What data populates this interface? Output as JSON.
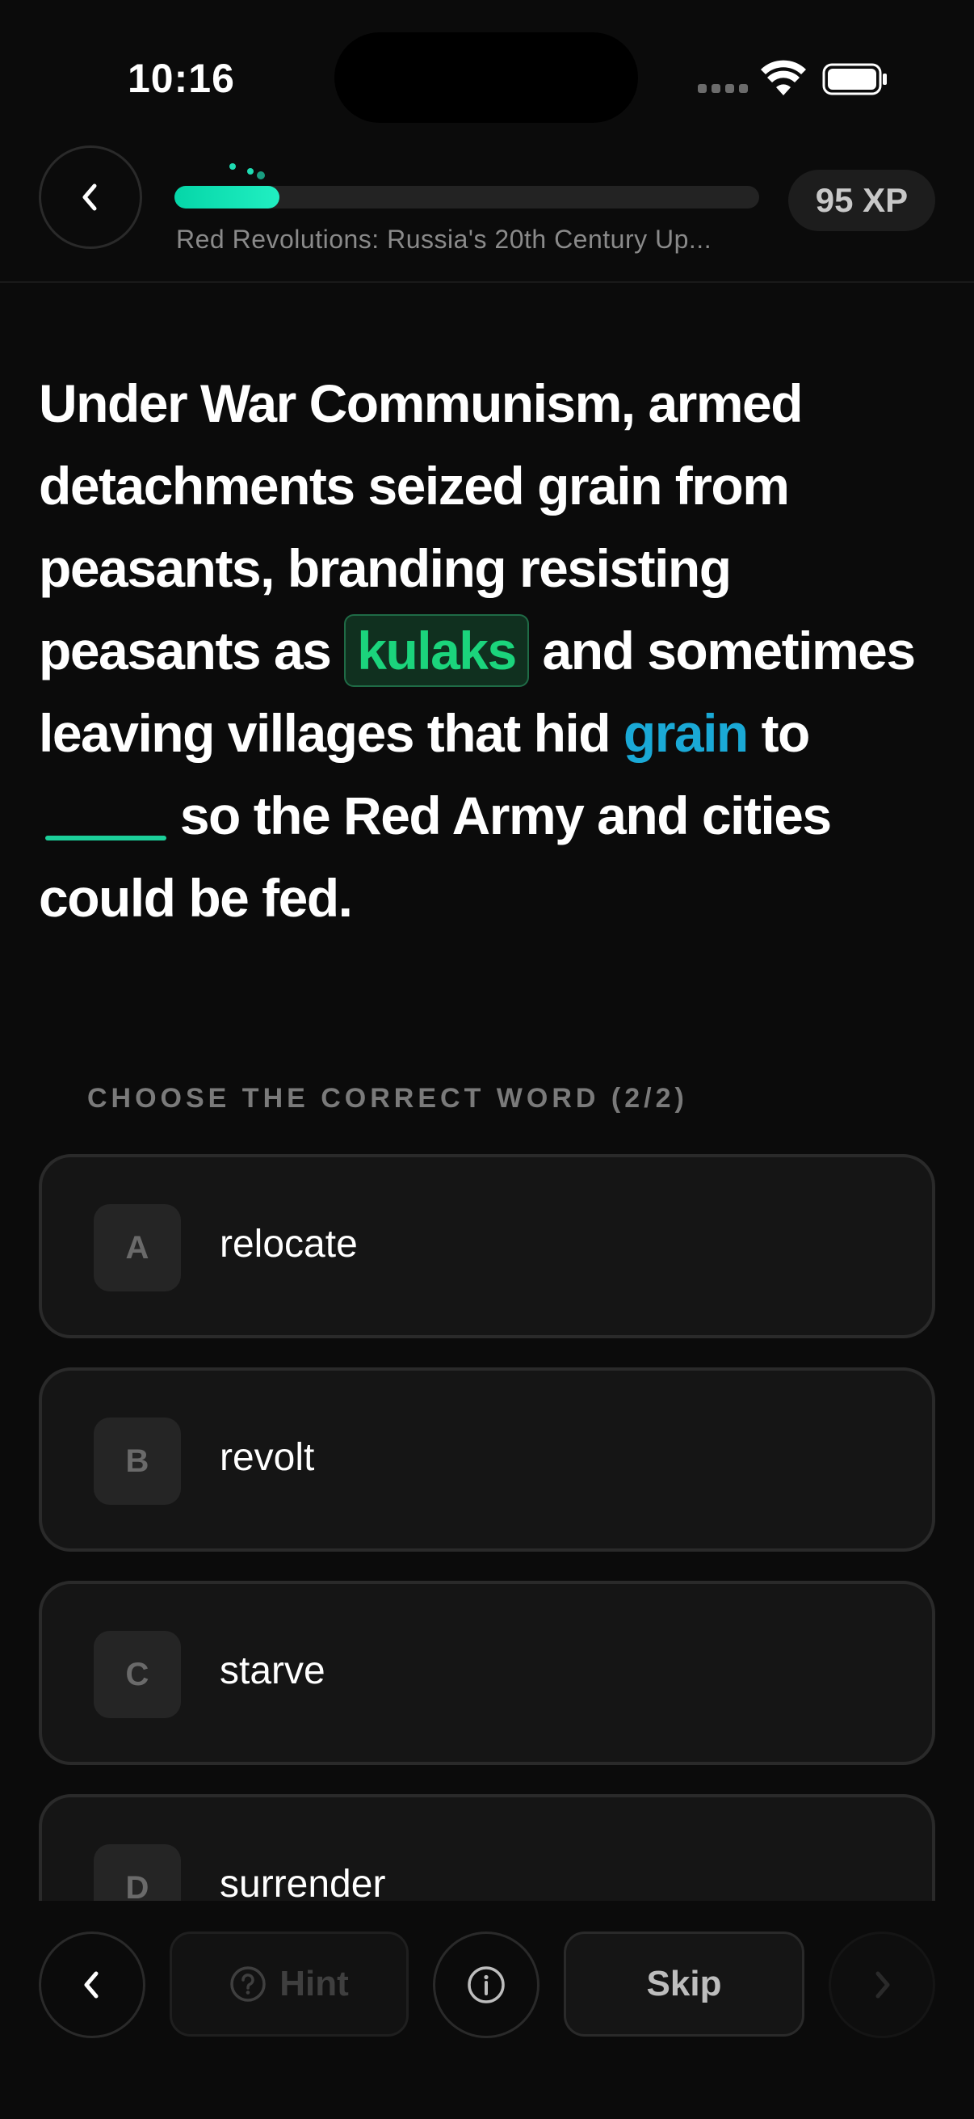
{
  "status_bar": {
    "time": "10:16"
  },
  "header": {
    "back_icon": "chevron-left-icon",
    "progress_percent": 18,
    "lesson_title": "Red Revolutions: Russia's 20th Century Up...",
    "xp_label": "95 XP",
    "colors": {
      "progress": "#05d6a8"
    }
  },
  "question": {
    "part1": "Under War Communism, armed detachments seized grain from peasants, branding resisting peasants as ",
    "highlight1": "kulaks",
    "part2": " and sometimes leaving villages that hid ",
    "highlight2": "grain",
    "part3": " to ",
    "part4": " so the Red Army and cities could be fed.",
    "colors": {
      "kulaks": "#1bd47c",
      "grain": "#1aa9d6",
      "blank": "#1ccf9a"
    }
  },
  "prompt": "CHOOSE THE CORRECT WORD (2/2)",
  "options": [
    {
      "letter": "A",
      "text": "relocate"
    },
    {
      "letter": "B",
      "text": "revolt"
    },
    {
      "letter": "C",
      "text": "starve"
    },
    {
      "letter": "D",
      "text": "surrender"
    }
  ],
  "bottom_bar": {
    "back_icon": "chevron-left-icon",
    "hint_icon": "question-circle-icon",
    "hint_label": "Hint",
    "info_icon": "info-circle-icon",
    "skip_label": "Skip",
    "next_icon": "chevron-right-icon"
  }
}
